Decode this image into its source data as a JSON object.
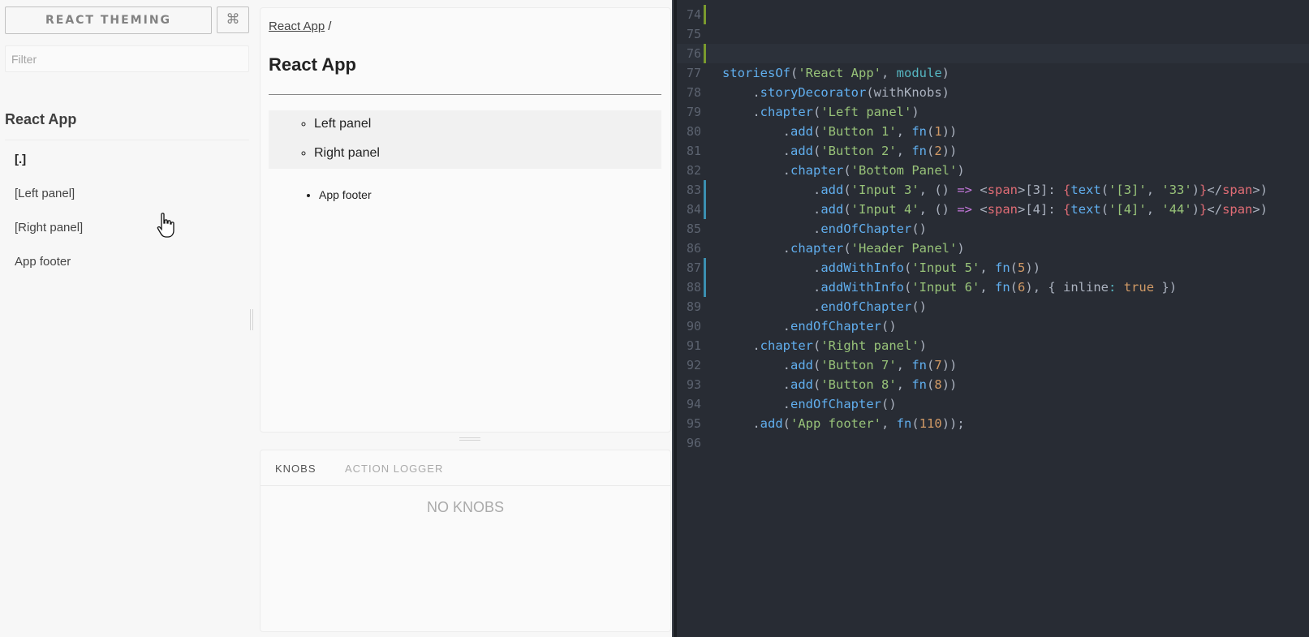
{
  "sidebar": {
    "brand": "REACT THEMING",
    "shortcut_icon": "⌘",
    "filter_placeholder": "Filter",
    "kind_title": "React App",
    "stories": [
      "[.]",
      "[Left panel]",
      "[Right panel]",
      "App footer"
    ],
    "selected_story": "[.]"
  },
  "preview": {
    "breadcrumb_link": "React App",
    "breadcrumb_sep": "/",
    "title": "React App",
    "panels": [
      "Left panel",
      "Right panel"
    ],
    "footer_items": [
      "App footer"
    ]
  },
  "addons": {
    "tabs": [
      "KNOBS",
      "ACTION LOGGER"
    ],
    "active_tab": "KNOBS",
    "empty_message": "NO KNOBS"
  },
  "editor": {
    "current_line": 76,
    "lines": [
      {
        "n": "74",
        "mark": "green",
        "tokens": []
      },
      {
        "n": "75",
        "mark": "",
        "tokens": []
      },
      {
        "n": "76",
        "mark": "green",
        "tokens": []
      },
      {
        "n": "77",
        "mark": "",
        "tokens": [
          [
            "t-fn",
            "storiesOf"
          ],
          [
            "t-plain",
            "("
          ],
          [
            "t-str",
            "'React App'"
          ],
          [
            "t-plain",
            ", "
          ],
          [
            "t-cy",
            "module"
          ],
          [
            "t-plain",
            ")"
          ]
        ]
      },
      {
        "n": "78",
        "mark": "",
        "tokens": [
          [
            "t-plain",
            "    ."
          ],
          [
            "t-fn",
            "storyDecorator"
          ],
          [
            "t-plain",
            "(withKnobs)"
          ]
        ]
      },
      {
        "n": "79",
        "mark": "",
        "tokens": [
          [
            "t-plain",
            "    ."
          ],
          [
            "t-fn",
            "chapter"
          ],
          [
            "t-plain",
            "("
          ],
          [
            "t-str",
            "'Left panel'"
          ],
          [
            "t-plain",
            ")"
          ]
        ]
      },
      {
        "n": "80",
        "mark": "",
        "tokens": [
          [
            "t-plain",
            "        ."
          ],
          [
            "t-fn",
            "add"
          ],
          [
            "t-plain",
            "("
          ],
          [
            "t-str",
            "'Button 1'"
          ],
          [
            "t-plain",
            ", "
          ],
          [
            "t-fn",
            "fn"
          ],
          [
            "t-plain",
            "("
          ],
          [
            "t-num",
            "1"
          ],
          [
            "t-plain",
            "))"
          ]
        ]
      },
      {
        "n": "81",
        "mark": "",
        "tokens": [
          [
            "t-plain",
            "        ."
          ],
          [
            "t-fn",
            "add"
          ],
          [
            "t-plain",
            "("
          ],
          [
            "t-str",
            "'Button 2'"
          ],
          [
            "t-plain",
            ", "
          ],
          [
            "t-fn",
            "fn"
          ],
          [
            "t-plain",
            "("
          ],
          [
            "t-num",
            "2"
          ],
          [
            "t-plain",
            "))"
          ]
        ]
      },
      {
        "n": "82",
        "mark": "",
        "tokens": [
          [
            "t-plain",
            "        ."
          ],
          [
            "t-fn",
            "chapter"
          ],
          [
            "t-plain",
            "("
          ],
          [
            "t-str",
            "'Bottom Panel'"
          ],
          [
            "t-plain",
            ")"
          ]
        ]
      },
      {
        "n": "83",
        "mark": "blue",
        "tokens": [
          [
            "t-plain",
            "            ."
          ],
          [
            "t-fn",
            "add"
          ],
          [
            "t-plain",
            "("
          ],
          [
            "t-str",
            "'Input 3'"
          ],
          [
            "t-plain",
            ", () "
          ],
          [
            "t-kw",
            "=>"
          ],
          [
            "t-plain",
            " <"
          ],
          [
            "t-tag",
            "span"
          ],
          [
            "t-plain",
            ">[3]: "
          ],
          [
            "t-prop",
            "{"
          ],
          [
            "t-fn",
            "text"
          ],
          [
            "t-plain",
            "("
          ],
          [
            "t-str",
            "'[3]'"
          ],
          [
            "t-plain",
            ", "
          ],
          [
            "t-str",
            "'33'"
          ],
          [
            "t-plain",
            ")"
          ],
          [
            "t-prop",
            "}"
          ],
          [
            "t-plain",
            "</"
          ],
          [
            "t-tag",
            "span"
          ],
          [
            "t-plain",
            ">)"
          ]
        ]
      },
      {
        "n": "84",
        "mark": "blue",
        "tokens": [
          [
            "t-plain",
            "            ."
          ],
          [
            "t-fn",
            "add"
          ],
          [
            "t-plain",
            "("
          ],
          [
            "t-str",
            "'Input 4'"
          ],
          [
            "t-plain",
            ", () "
          ],
          [
            "t-kw",
            "=>"
          ],
          [
            "t-plain",
            " <"
          ],
          [
            "t-tag",
            "span"
          ],
          [
            "t-plain",
            ">[4]: "
          ],
          [
            "t-prop",
            "{"
          ],
          [
            "t-fn",
            "text"
          ],
          [
            "t-plain",
            "("
          ],
          [
            "t-str",
            "'[4]'"
          ],
          [
            "t-plain",
            ", "
          ],
          [
            "t-str",
            "'44'"
          ],
          [
            "t-plain",
            ")"
          ],
          [
            "t-prop",
            "}"
          ],
          [
            "t-plain",
            "</"
          ],
          [
            "t-tag",
            "span"
          ],
          [
            "t-plain",
            ">)"
          ]
        ]
      },
      {
        "n": "85",
        "mark": "",
        "tokens": [
          [
            "t-plain",
            "            ."
          ],
          [
            "t-fn",
            "endOfChapter"
          ],
          [
            "t-plain",
            "()"
          ]
        ]
      },
      {
        "n": "86",
        "mark": "",
        "tokens": [
          [
            "t-plain",
            "        ."
          ],
          [
            "t-fn",
            "chapter"
          ],
          [
            "t-plain",
            "("
          ],
          [
            "t-str",
            "'Header Panel'"
          ],
          [
            "t-plain",
            ")"
          ]
        ]
      },
      {
        "n": "87",
        "mark": "blue",
        "tokens": [
          [
            "t-plain",
            "            ."
          ],
          [
            "t-fn",
            "addWithInfo"
          ],
          [
            "t-plain",
            "("
          ],
          [
            "t-str",
            "'Input 5'"
          ],
          [
            "t-plain",
            ", "
          ],
          [
            "t-fn",
            "fn"
          ],
          [
            "t-plain",
            "("
          ],
          [
            "t-num",
            "5"
          ],
          [
            "t-plain",
            "))"
          ]
        ]
      },
      {
        "n": "88",
        "mark": "blue",
        "tokens": [
          [
            "t-plain",
            "            ."
          ],
          [
            "t-fn",
            "addWithInfo"
          ],
          [
            "t-plain",
            "("
          ],
          [
            "t-str",
            "'Input 6'"
          ],
          [
            "t-plain",
            ", "
          ],
          [
            "t-fn",
            "fn"
          ],
          [
            "t-plain",
            "("
          ],
          [
            "t-num",
            "6"
          ],
          [
            "t-plain",
            "), { inline"
          ],
          [
            "t-cy",
            ":"
          ],
          [
            "t-plain",
            " "
          ],
          [
            "t-num",
            "true"
          ],
          [
            "t-plain",
            " })"
          ]
        ]
      },
      {
        "n": "89",
        "mark": "",
        "tokens": [
          [
            "t-plain",
            "            ."
          ],
          [
            "t-fn",
            "endOfChapter"
          ],
          [
            "t-plain",
            "()"
          ]
        ]
      },
      {
        "n": "90",
        "mark": "",
        "tokens": [
          [
            "t-plain",
            "        ."
          ],
          [
            "t-fn",
            "endOfChapter"
          ],
          [
            "t-plain",
            "()"
          ]
        ]
      },
      {
        "n": "91",
        "mark": "",
        "tokens": [
          [
            "t-plain",
            "    ."
          ],
          [
            "t-fn",
            "chapter"
          ],
          [
            "t-plain",
            "("
          ],
          [
            "t-str",
            "'Right panel'"
          ],
          [
            "t-plain",
            ")"
          ]
        ]
      },
      {
        "n": "92",
        "mark": "",
        "tokens": [
          [
            "t-plain",
            "        ."
          ],
          [
            "t-fn",
            "add"
          ],
          [
            "t-plain",
            "("
          ],
          [
            "t-str",
            "'Button 7'"
          ],
          [
            "t-plain",
            ", "
          ],
          [
            "t-fn",
            "fn"
          ],
          [
            "t-plain",
            "("
          ],
          [
            "t-num",
            "7"
          ],
          [
            "t-plain",
            "))"
          ]
        ]
      },
      {
        "n": "93",
        "mark": "",
        "tokens": [
          [
            "t-plain",
            "        ."
          ],
          [
            "t-fn",
            "add"
          ],
          [
            "t-plain",
            "("
          ],
          [
            "t-str",
            "'Button 8'"
          ],
          [
            "t-plain",
            ", "
          ],
          [
            "t-fn",
            "fn"
          ],
          [
            "t-plain",
            "("
          ],
          [
            "t-num",
            "8"
          ],
          [
            "t-plain",
            "))"
          ]
        ]
      },
      {
        "n": "94",
        "mark": "",
        "tokens": [
          [
            "t-plain",
            "        ."
          ],
          [
            "t-fn",
            "endOfChapter"
          ],
          [
            "t-plain",
            "()"
          ]
        ]
      },
      {
        "n": "95",
        "mark": "",
        "tokens": [
          [
            "t-plain",
            "    ."
          ],
          [
            "t-fn",
            "add"
          ],
          [
            "t-plain",
            "("
          ],
          [
            "t-str",
            "'App footer'"
          ],
          [
            "t-plain",
            ", "
          ],
          [
            "t-fn",
            "fn"
          ],
          [
            "t-plain",
            "("
          ],
          [
            "t-num",
            "110"
          ],
          [
            "t-plain",
            "));"
          ]
        ]
      },
      {
        "n": "96",
        "mark": "",
        "tokens": []
      }
    ]
  }
}
